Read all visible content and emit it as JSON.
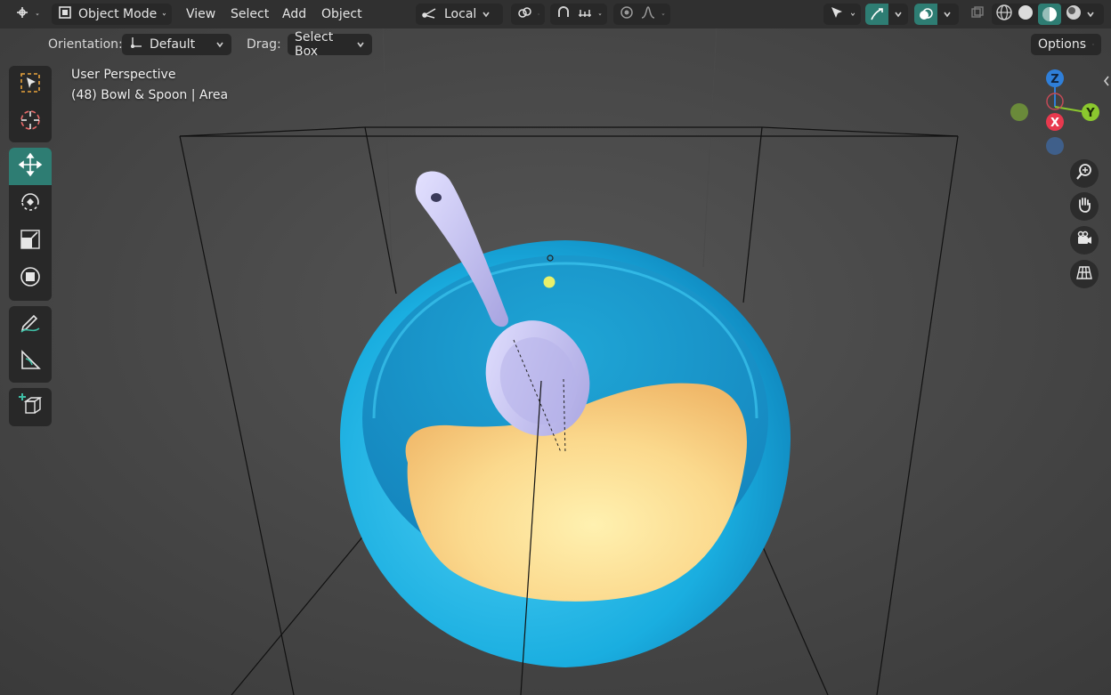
{
  "header": {
    "mode_label": "Object Mode",
    "menus": [
      "View",
      "Select",
      "Add",
      "Object"
    ],
    "pivot_label": "Local"
  },
  "tool_settings": {
    "orientation_label": "Orientation:",
    "orientation_value": "Default",
    "drag_label": "Drag:",
    "drag_value": "Select Box",
    "options_label": "Options"
  },
  "viewport": {
    "view_name": "User Perspective",
    "object_info": "(48) Bowl & Spoon | Area"
  },
  "gizmo": {
    "axes": [
      "Z",
      "X",
      "Y"
    ]
  },
  "colors": {
    "accent": "#2e7d73",
    "bowl": "#29b9e8",
    "food": "#f5c77a",
    "spoon": "#c9c6f0",
    "axis_x": "#e8394e",
    "axis_y": "#8bc82e",
    "axis_z": "#2f7fd9"
  }
}
